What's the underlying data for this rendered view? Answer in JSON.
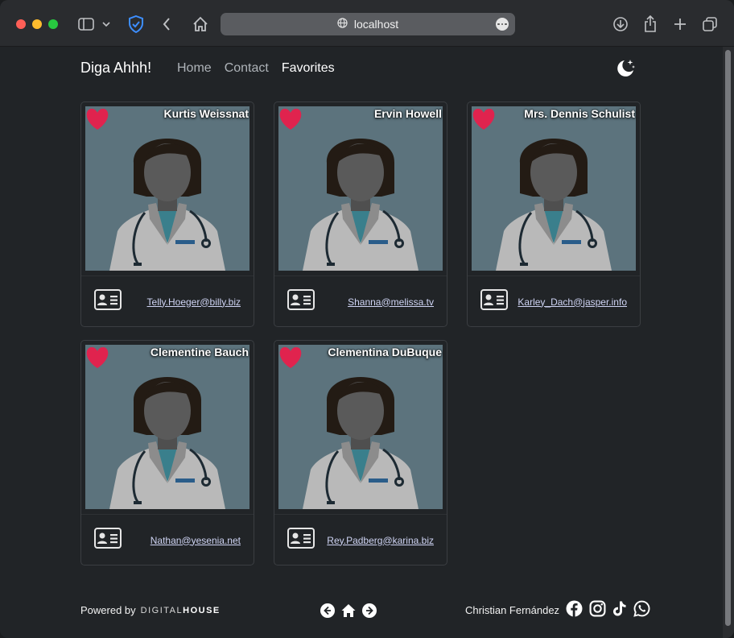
{
  "browser": {
    "url": "localhost",
    "icons": [
      "sidebar-icon",
      "chevron-down-icon",
      "shield-icon",
      "back-icon",
      "home-icon",
      "globe-icon",
      "more-icon",
      "download-icon",
      "share-icon",
      "new-tab-icon",
      "tabs-icon"
    ]
  },
  "header": {
    "brand": "Diga Ahhh!",
    "nav": [
      {
        "label": "Home",
        "active": false
      },
      {
        "label": "Contact",
        "active": false
      },
      {
        "label": "Favorites",
        "active": true
      }
    ],
    "theme_toggle_icon": "moon-icon"
  },
  "cards": [
    {
      "name": "Kurtis Weissnat",
      "email": "Telly.Hoeger@billy.biz",
      "favorite": true
    },
    {
      "name": "Ervin Howell",
      "email": "Shanna@melissa.tv",
      "favorite": true
    },
    {
      "name": "Mrs. Dennis Schulist",
      "email": "Karley_Dach@jasper.info",
      "favorite": true
    },
    {
      "name": "Clementine Bauch",
      "email": "Nathan@yesenia.net",
      "favorite": true
    },
    {
      "name": "Clementina DuBuque",
      "email": "Rey.Padberg@karina.biz",
      "favorite": true
    }
  ],
  "footer": {
    "powered_by": "Powered by",
    "brand_digital": "DIGITAL",
    "brand_house": "HOUSE",
    "author": "Christian Fernández",
    "socials": [
      "facebook-icon",
      "instagram-icon",
      "tiktok-icon",
      "whatsapp-icon"
    ]
  },
  "colors": {
    "background": "#212427",
    "heart": "#e0234e",
    "avatar_bg": "#5c737d",
    "link": "#cfd4f4"
  }
}
